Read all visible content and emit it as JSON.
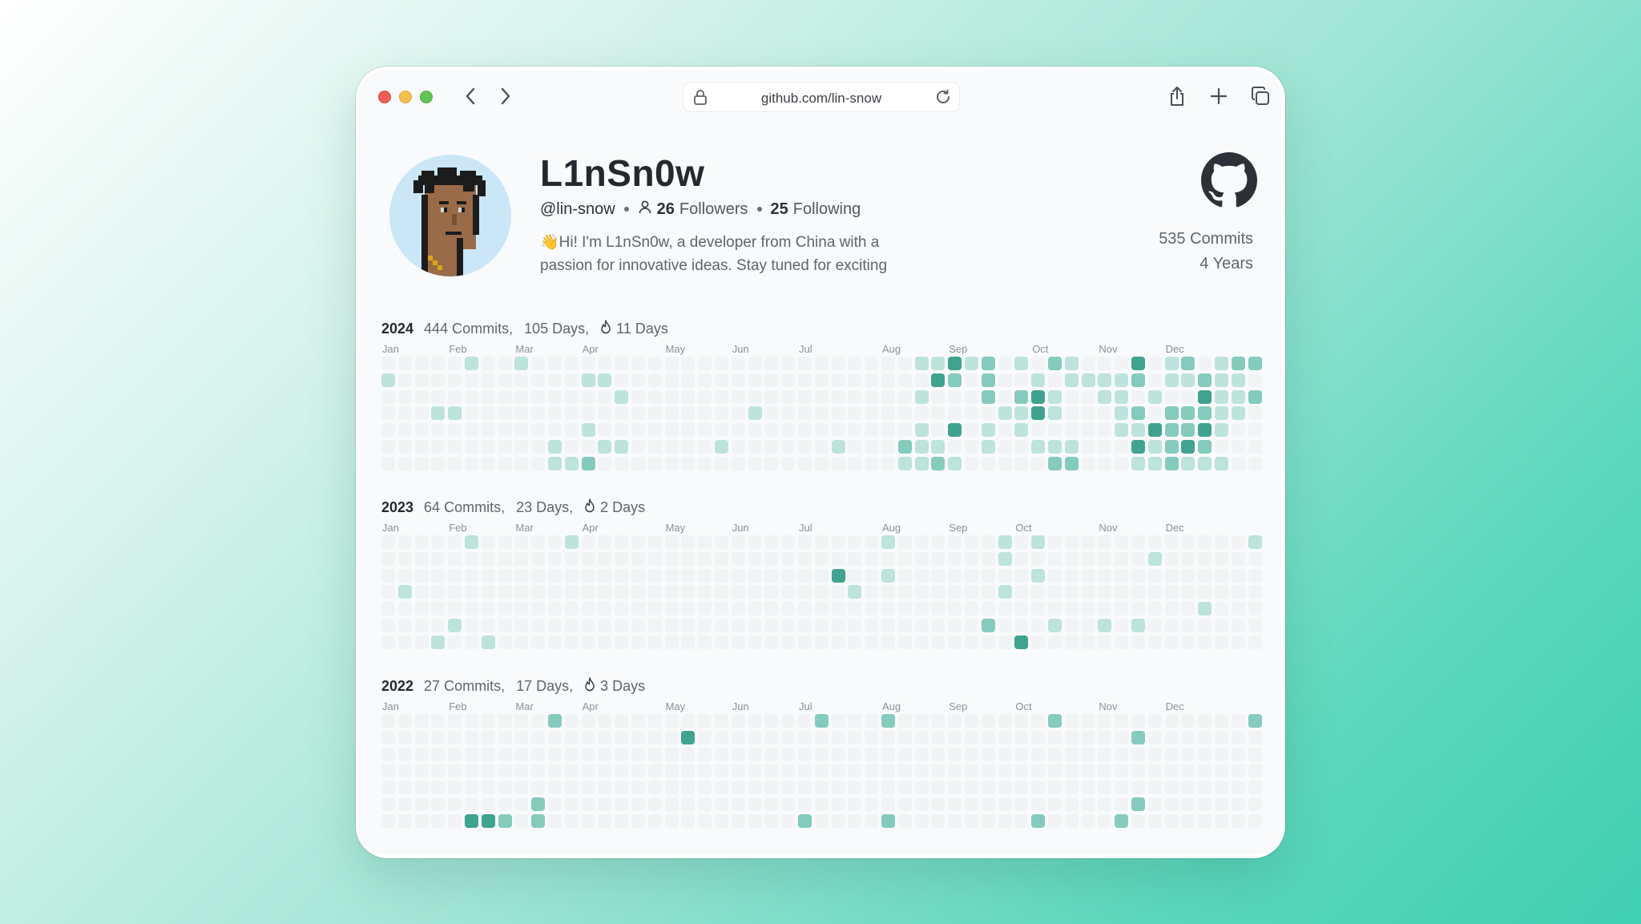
{
  "browser": {
    "url": "github.com/lin-snow",
    "icons": [
      "chevron-left-icon",
      "chevron-right-icon",
      "lock-icon",
      "reload-icon",
      "share-icon",
      "plus-icon",
      "tabs-icon"
    ]
  },
  "profile": {
    "name": "L1nSn0w",
    "handle": "@lin-snow",
    "followers_count": "26",
    "followers_label": "Followers",
    "following_count": "25",
    "following_label": "Following",
    "bio": "👋Hi! I'm L1nSn0w, a developer from China with a passion for innovative ideas. Stay tuned for exciting",
    "total_commits": "535 Commits",
    "years": "4 Years"
  },
  "colors": {
    "empty": "#f1f3f4",
    "level1": "#bde3dc",
    "level2": "#85cbbd",
    "level3": "#3fa38f"
  },
  "months": [
    "Jan",
    "Feb",
    "Mar",
    "Apr",
    "May",
    "Jun",
    "Jul",
    "Aug",
    "Sep",
    "Oct",
    "Nov",
    "Dec"
  ],
  "calendars": [
    {
      "year": "2024",
      "commits": "444 Commits,",
      "days": "105 Days,",
      "streak": "11 Days",
      "month_weeks": [
        0,
        4,
        8,
        12,
        17,
        21,
        25,
        30,
        34,
        39,
        43,
        47
      ],
      "cells": [
        [
          5,
          0,
          1
        ],
        [
          8,
          0,
          1
        ],
        [
          32,
          0,
          1
        ],
        [
          33,
          0,
          1
        ],
        [
          34,
          0,
          3
        ],
        [
          35,
          0,
          1
        ],
        [
          36,
          0,
          2
        ],
        [
          38,
          0,
          1
        ],
        [
          40,
          0,
          2
        ],
        [
          41,
          0,
          1
        ],
        [
          45,
          0,
          3
        ],
        [
          47,
          0,
          1
        ],
        [
          48,
          0,
          2
        ],
        [
          50,
          0,
          1
        ],
        [
          51,
          0,
          2
        ],
        [
          52,
          0,
          2
        ],
        [
          0,
          1,
          1
        ],
        [
          12,
          1,
          1
        ],
        [
          13,
          1,
          1
        ],
        [
          33,
          1,
          3
        ],
        [
          34,
          1,
          2
        ],
        [
          36,
          1,
          2
        ],
        [
          39,
          1,
          1
        ],
        [
          41,
          1,
          1
        ],
        [
          42,
          1,
          1
        ],
        [
          43,
          1,
          1
        ],
        [
          44,
          1,
          1
        ],
        [
          45,
          1,
          2
        ],
        [
          47,
          1,
          1
        ],
        [
          48,
          1,
          1
        ],
        [
          49,
          1,
          2
        ],
        [
          50,
          1,
          1
        ],
        [
          51,
          1,
          1
        ],
        [
          14,
          2,
          1
        ],
        [
          32,
          2,
          1
        ],
        [
          36,
          2,
          2
        ],
        [
          38,
          2,
          2
        ],
        [
          39,
          2,
          3
        ],
        [
          40,
          2,
          1
        ],
        [
          43,
          2,
          1
        ],
        [
          44,
          2,
          1
        ],
        [
          46,
          2,
          1
        ],
        [
          49,
          2,
          3
        ],
        [
          50,
          2,
          1
        ],
        [
          51,
          2,
          1
        ],
        [
          52,
          2,
          2
        ],
        [
          3,
          3,
          1
        ],
        [
          4,
          3,
          1
        ],
        [
          22,
          3,
          1
        ],
        [
          37,
          3,
          1
        ],
        [
          38,
          3,
          1
        ],
        [
          39,
          3,
          3
        ],
        [
          40,
          3,
          1
        ],
        [
          44,
          3,
          1
        ],
        [
          45,
          3,
          2
        ],
        [
          47,
          3,
          2
        ],
        [
          48,
          3,
          2
        ],
        [
          49,
          3,
          2
        ],
        [
          50,
          3,
          1
        ],
        [
          51,
          3,
          1
        ],
        [
          12,
          4,
          1
        ],
        [
          32,
          4,
          1
        ],
        [
          34,
          4,
          3
        ],
        [
          36,
          4,
          1
        ],
        [
          38,
          4,
          1
        ],
        [
          44,
          4,
          1
        ],
        [
          45,
          4,
          1
        ],
        [
          46,
          4,
          3
        ],
        [
          47,
          4,
          2
        ],
        [
          48,
          4,
          2
        ],
        [
          49,
          4,
          3
        ],
        [
          50,
          4,
          1
        ],
        [
          10,
          5,
          1
        ],
        [
          13,
          5,
          1
        ],
        [
          14,
          5,
          1
        ],
        [
          20,
          5,
          1
        ],
        [
          27,
          5,
          1
        ],
        [
          31,
          5,
          2
        ],
        [
          32,
          5,
          1
        ],
        [
          33,
          5,
          1
        ],
        [
          36,
          5,
          1
        ],
        [
          39,
          5,
          1
        ],
        [
          40,
          5,
          1
        ],
        [
          41,
          5,
          1
        ],
        [
          45,
          5,
          3
        ],
        [
          46,
          5,
          1
        ],
        [
          47,
          5,
          2
        ],
        [
          48,
          5,
          3
        ],
        [
          49,
          5,
          2
        ],
        [
          10,
          6,
          1
        ],
        [
          11,
          6,
          1
        ],
        [
          12,
          6,
          2
        ],
        [
          31,
          6,
          1
        ],
        [
          32,
          6,
          1
        ],
        [
          33,
          6,
          2
        ],
        [
          34,
          6,
          1
        ],
        [
          40,
          6,
          2
        ],
        [
          41,
          6,
          2
        ],
        [
          45,
          6,
          1
        ],
        [
          46,
          6,
          1
        ],
        [
          47,
          6,
          2
        ],
        [
          48,
          6,
          1
        ],
        [
          49,
          6,
          1
        ],
        [
          50,
          6,
          1
        ]
      ]
    },
    {
      "year": "2023",
      "commits": "64 Commits,",
      "days": "23 Days,",
      "streak": "2 Days",
      "month_weeks": [
        0,
        4,
        8,
        12,
        17,
        21,
        25,
        30,
        34,
        38,
        43,
        47
      ],
      "cells": [
        [
          5,
          0,
          1
        ],
        [
          11,
          0,
          1
        ],
        [
          30,
          0,
          1
        ],
        [
          37,
          0,
          1
        ],
        [
          39,
          0,
          1
        ],
        [
          52,
          0,
          1
        ],
        [
          37,
          1,
          1
        ],
        [
          46,
          1,
          1
        ],
        [
          27,
          2,
          3
        ],
        [
          30,
          2,
          1
        ],
        [
          39,
          2,
          1
        ],
        [
          1,
          3,
          1
        ],
        [
          28,
          3,
          1
        ],
        [
          37,
          3,
          1
        ],
        [
          49,
          4,
          1
        ],
        [
          4,
          5,
          1
        ],
        [
          36,
          5,
          2
        ],
        [
          40,
          5,
          1
        ],
        [
          43,
          5,
          1
        ],
        [
          45,
          5,
          1
        ],
        [
          3,
          6,
          1
        ],
        [
          6,
          6,
          1
        ],
        [
          38,
          6,
          3
        ]
      ]
    },
    {
      "year": "2022",
      "commits": "27 Commits,",
      "days": "17 Days,",
      "streak": "3 Days",
      "month_weeks": [
        0,
        4,
        8,
        12,
        17,
        21,
        25,
        30,
        34,
        38,
        43,
        47
      ],
      "cells": [
        [
          10,
          0,
          2
        ],
        [
          26,
          0,
          2
        ],
        [
          30,
          0,
          2
        ],
        [
          40,
          0,
          2
        ],
        [
          52,
          0,
          2
        ],
        [
          18,
          1,
          3
        ],
        [
          45,
          1,
          2
        ],
        [
          9,
          5,
          2
        ],
        [
          45,
          5,
          2
        ],
        [
          5,
          6,
          3
        ],
        [
          6,
          6,
          3
        ],
        [
          7,
          6,
          2
        ],
        [
          9,
          6,
          2
        ],
        [
          25,
          6,
          2
        ],
        [
          30,
          6,
          2
        ],
        [
          39,
          6,
          2
        ],
        [
          44,
          6,
          2
        ]
      ]
    }
  ]
}
